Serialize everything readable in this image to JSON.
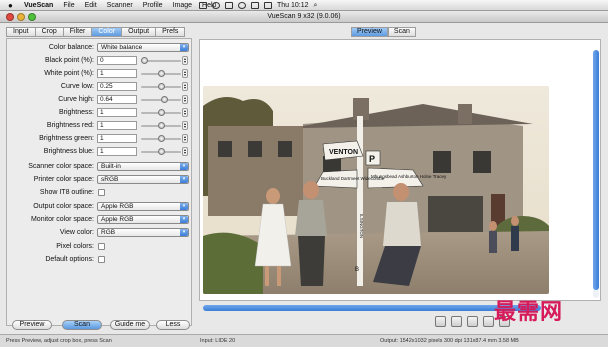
{
  "menubar": {
    "apple_icon": "apple-icon",
    "items": [
      "VueScan",
      "File",
      "Edit",
      "Scanner",
      "Profile",
      "Image",
      "Help"
    ],
    "clock": "Thu 10:12"
  },
  "window": {
    "title": "VueScan 9 x32 (9.0.06)"
  },
  "left_tabs": [
    "Input",
    "Crop",
    "Filter",
    "Color",
    "Output",
    "Prefs"
  ],
  "selected_left_tab": "Color",
  "settings": {
    "color_balance": {
      "label": "Color balance:",
      "value": "White balance"
    },
    "black_point": {
      "label": "Black point (%):",
      "value": "0",
      "level": 0.0
    },
    "white_point": {
      "label": "White point (%):",
      "value": "1",
      "level": 0.5
    },
    "curve_low": {
      "label": "Curve low:",
      "value": "0.25",
      "level": 0.5
    },
    "curve_high": {
      "label": "Curve high:",
      "value": "0.64",
      "level": 0.6
    },
    "brightness": {
      "label": "Brightness:",
      "value": "1",
      "level": 0.5
    },
    "brightness_red": {
      "label": "Brightness red:",
      "value": "1",
      "level": 0.5
    },
    "brightness_green": {
      "label": "Brightness green:",
      "value": "1",
      "level": 0.5
    },
    "brightness_blue": {
      "label": "Brightness blue:",
      "value": "1",
      "level": 0.5
    },
    "scanner_color_space": {
      "label": "Scanner color space:",
      "value": "Built-in"
    },
    "printer_color_space": {
      "label": "Printer color space:",
      "value": "sRGB"
    },
    "show_it8_outline": {
      "label": "Show IT8 outline:"
    },
    "output_color_space": {
      "label": "Output color space:",
      "value": "Apple RGB"
    },
    "monitor_color_space": {
      "label": "Monitor color space:",
      "value": "Apple RGB"
    },
    "view_color": {
      "label": "View color:",
      "value": "RGB"
    },
    "pixel_colors": {
      "label": "Pixel colors:"
    },
    "default_options": {
      "label": "Default options:"
    }
  },
  "bottom_buttons": {
    "preview": "Preview",
    "scan": "Scan",
    "guide": "Guide me",
    "less": "Less"
  },
  "right_tabs": [
    "Preview",
    "Scan"
  ],
  "selected_right_tab": "Preview",
  "photo": {
    "sign_venton": "VENTON",
    "sign_p": "P",
    "sign_left": "Buckland Dartmeet Widecombe",
    "sign_right": "Mhungsbead Ashburton Holne Tracey",
    "sign_post": "ILSINGTON",
    "sign_b": "B"
  },
  "tool_icons": [
    "save-icon",
    "print-icon",
    "email-icon",
    "zoom-icon",
    "color-icon"
  ],
  "status": {
    "left": "Press Preview, adjust crop box, press Scan",
    "middle": "Input: LIDE 20",
    "right": "Output: 1542x1032 pixels 300 dpi 131x87.4 mm 3.58 MB"
  },
  "watermark": "最需网",
  "colors": {
    "accent": "#3b7ed8",
    "selected_tab": "#5d9be0"
  }
}
